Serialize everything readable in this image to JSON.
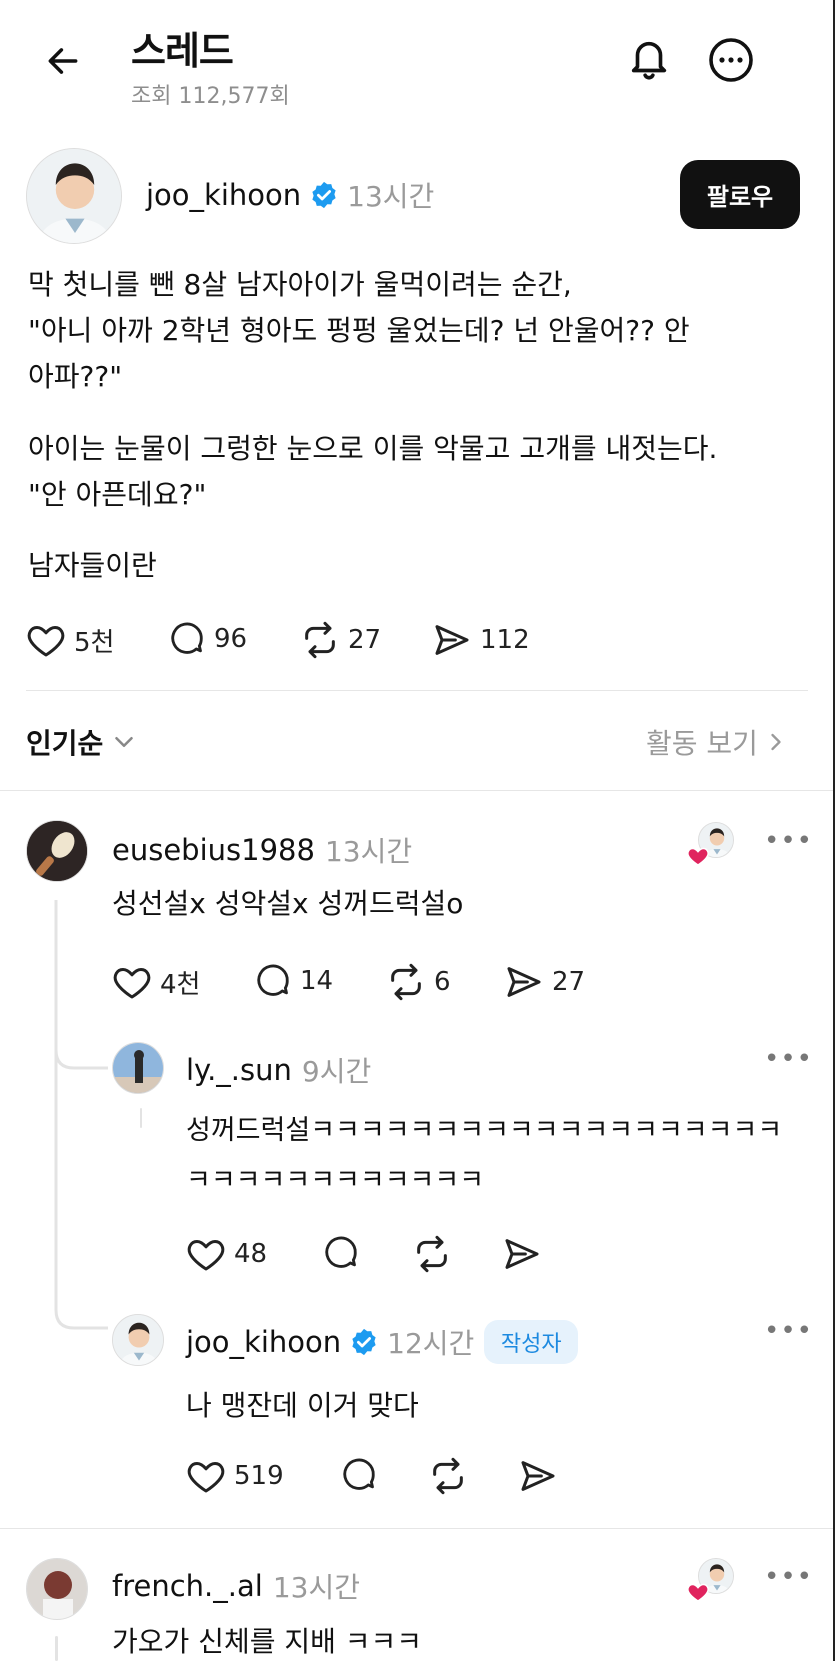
{
  "header": {
    "title": "스레드",
    "views": "조회 112,577회"
  },
  "post": {
    "username": "joo_kihoon",
    "time": "13시간",
    "follow_label": "팔로우",
    "paragraphs": [
      "막 첫니를 뺀 8살 남자아이가 울먹이려는 순간,",
      "\"아니 아까 2학년 형아도 펑펑 울었는데? 넌 안울어?? 안",
      "아파??\"",
      "아이는 눈물이 그렁한 눈으로 이를 악물고 고개를 내젓는다.",
      "\"안 아픈데요?\"",
      "남자들이란"
    ],
    "likes": "5천",
    "comments": "96",
    "reposts": "27",
    "shares": "112"
  },
  "sort": {
    "label": "인기순",
    "activity_label": "활동 보기"
  },
  "comments": [
    {
      "username": "eusebius1988",
      "time": "13시간",
      "text": "성선설x 성악설x 성꺼드럭설o",
      "likes": "4천",
      "comments": "14",
      "reposts": "6",
      "shares": "27"
    },
    {
      "username": "ly._.sun",
      "time": "9시간",
      "text_line1": "성꺼드럭설ㅋㅋㅋㅋㅋㅋㅋㅋㅋㅋㅋㅋㅋㅋㅋㅋㅋㅋㅋ",
      "text_line2": "ㅋㅋㅋㅋㅋㅋㅋㅋㅋㅋㅋㅋ",
      "likes": "48"
    },
    {
      "username": "joo_kihoon",
      "time": "12시간",
      "badge": "작성자",
      "text": "나 맹잔데 이거 맞다",
      "likes": "519"
    },
    {
      "username": "french._.al",
      "time": "13시간",
      "text": "가오가 신체를 지배 ㅋㅋㅋ"
    }
  ],
  "icons": {
    "back": "arrow-left-icon",
    "bell": "bell-icon",
    "more": "more-circle-icon",
    "verified": "verified-badge-icon",
    "heart": "heart-icon",
    "comment": "comment-icon",
    "repost": "repost-icon",
    "share": "share-icon",
    "chevron_down": "chevron-down-icon",
    "chevron_right": "chevron-right-icon"
  },
  "colors": {
    "verified": "#1d9bf0",
    "badge_bg": "#e6f2fc",
    "badge_text": "#1d8ae0",
    "like_heart": "#e0245e",
    "muted": "#9a9a9a"
  }
}
